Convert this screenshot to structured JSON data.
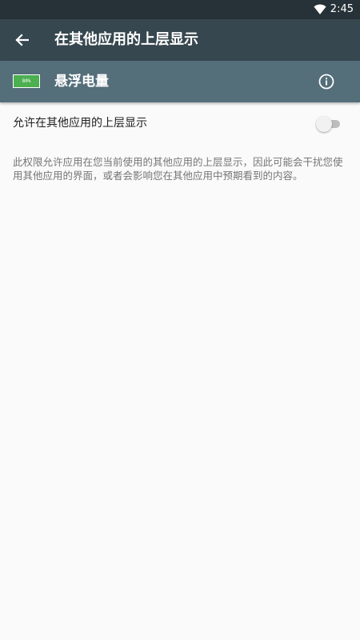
{
  "status_bar": {
    "time": "2:45",
    "wifi_icon": "wifi-icon"
  },
  "app_bar": {
    "back_icon": "arrow-back-icon",
    "title": "在其他应用的上层显示"
  },
  "app_header": {
    "icon_text": "80%",
    "app_name": "悬浮电量",
    "info_icon": "info-icon"
  },
  "setting": {
    "label": "允许在其他应用的上层显示",
    "enabled": false
  },
  "description": "此权限允许应用在您当前使用的其他应用的上层显示，因此可能会干扰您使用其他应用的界面，或者会影响您在其他应用中预期看到的内容。",
  "colors": {
    "status_bar": "#263238",
    "app_bar": "#37474f",
    "app_header": "#546e7a",
    "app_icon": "#4caf50",
    "background": "#fafafa"
  }
}
